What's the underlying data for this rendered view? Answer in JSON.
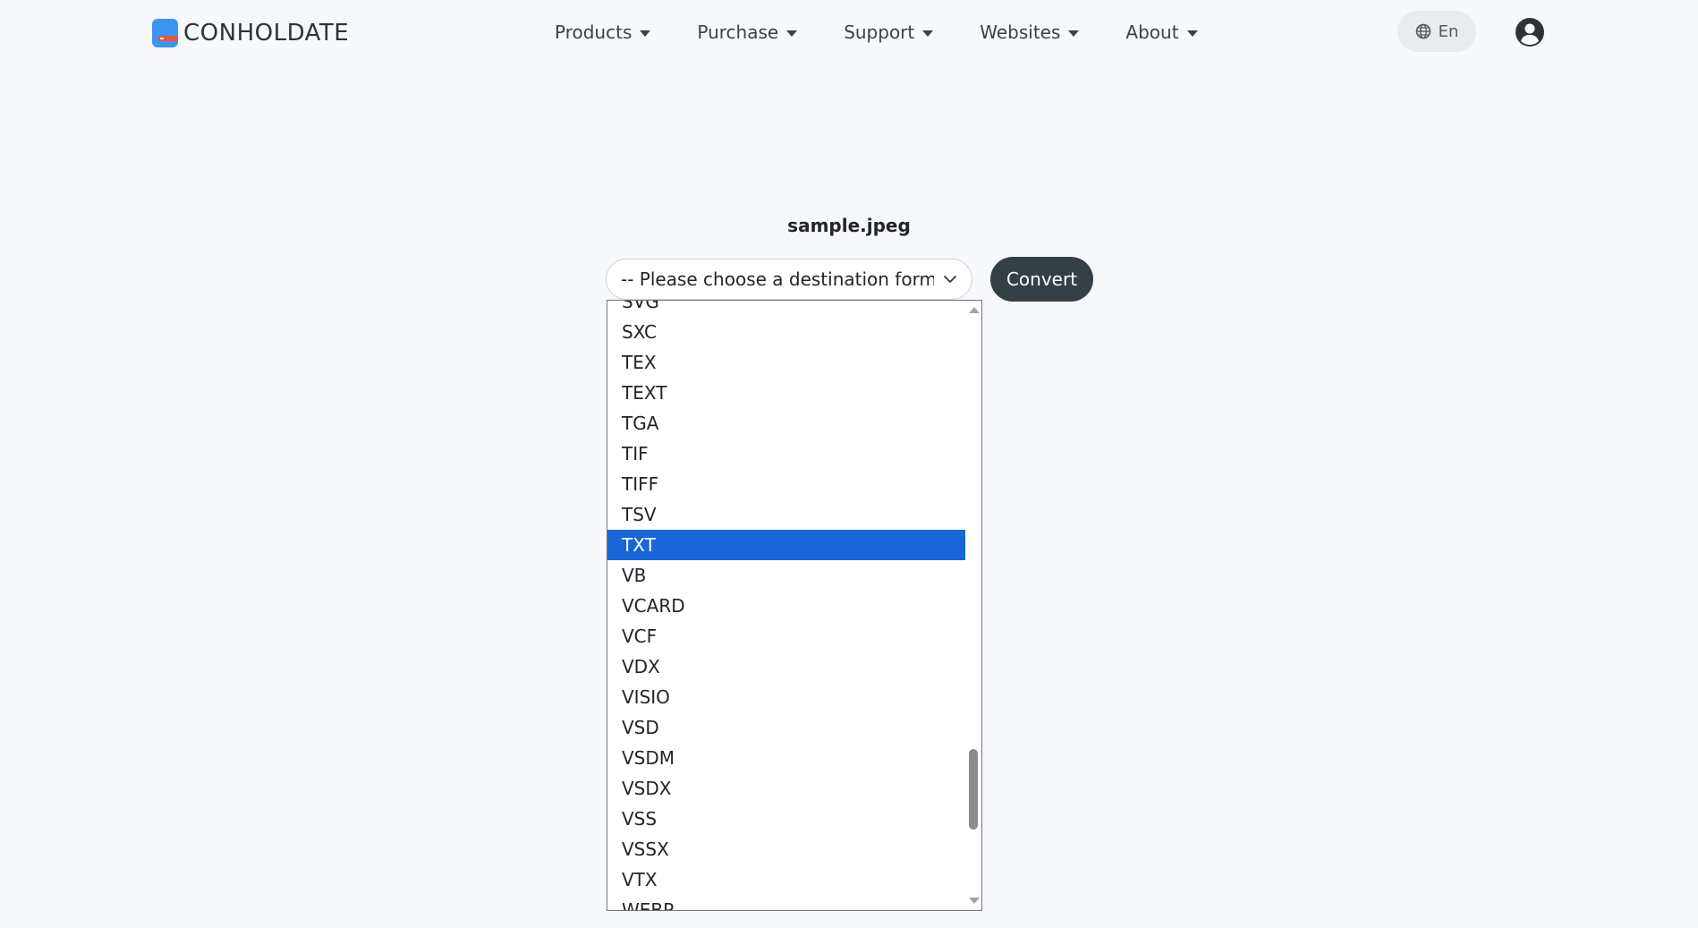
{
  "header": {
    "logo_text": "CONHOLDATE",
    "nav": [
      {
        "label": "Products"
      },
      {
        "label": "Purchase"
      },
      {
        "label": "Support"
      },
      {
        "label": "Websites"
      },
      {
        "label": "About"
      }
    ],
    "language": "En"
  },
  "main": {
    "file_name": "sample.jpeg",
    "select_placeholder": "-- Please choose a destination format --",
    "convert_label": "Convert"
  },
  "dropdown": {
    "options": [
      "SVG",
      "SXC",
      "TEX",
      "TEXT",
      "TGA",
      "TIF",
      "TIFF",
      "TSV",
      "TXT",
      "VB",
      "VCARD",
      "VCF",
      "VDX",
      "VISIO",
      "VSD",
      "VSDM",
      "VSDX",
      "VSS",
      "VSSX",
      "VTX",
      "WEBP"
    ],
    "selected": "TXT"
  },
  "colors": {
    "accent": "#1a66d6",
    "button_dark": "#343f46",
    "logo_blue": "#3b95f0",
    "logo_red": "#e8553f",
    "background": "#f6f8fb"
  }
}
